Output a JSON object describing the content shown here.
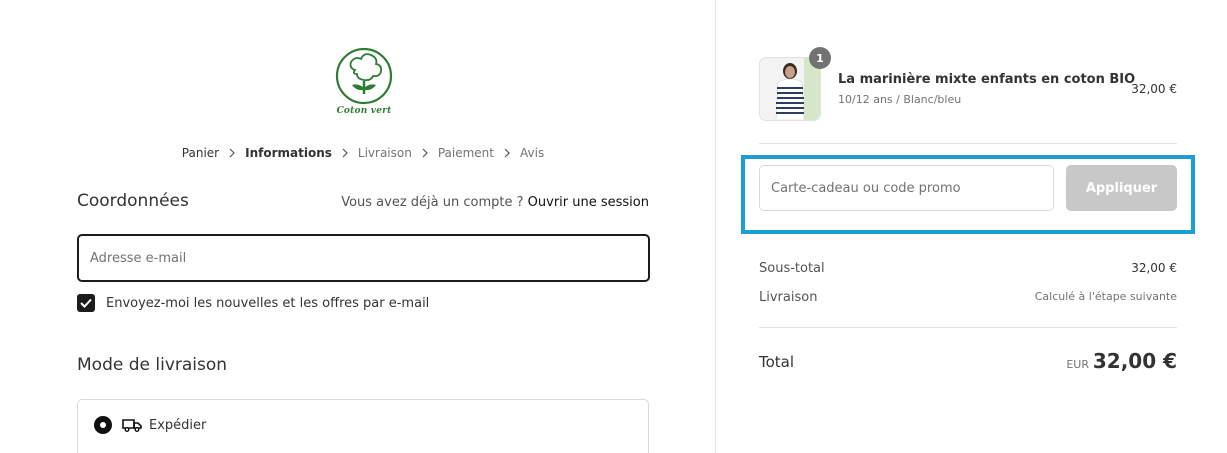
{
  "brand": {
    "logo_text": "Coton vert",
    "brand_color": "#2e7d32"
  },
  "breadcrumb": {
    "items": [
      {
        "label": "Panier",
        "state": "done"
      },
      {
        "label": "Informations",
        "state": "active"
      },
      {
        "label": "Livraison",
        "state": "upcoming"
      },
      {
        "label": "Paiement",
        "state": "upcoming"
      },
      {
        "label": "Avis",
        "state": "upcoming"
      }
    ],
    "separator_icon": "chevron-right-icon"
  },
  "contact": {
    "title": "Coordonnées",
    "login_prompt": "Vous avez déjà un compte ?",
    "login_link": "Ouvrir une session",
    "email_placeholder": "Adresse e-mail",
    "email_value": "",
    "newsletter_label": "Envoyez-moi les nouvelles et les offres par e-mail",
    "newsletter_checked": true
  },
  "shipping_method": {
    "title": "Mode de livraison",
    "option_label": "Expédier",
    "option_icon": "truck-icon",
    "selected": true
  },
  "order": {
    "product": {
      "name": "La marinière mixte enfants en coton BIO",
      "variant": "10/12 ans / Blanc/bleu",
      "price": "32,00 €",
      "quantity": "1"
    },
    "promo": {
      "placeholder": "Carte-cadeau ou code promo",
      "value": "",
      "apply_label": "Appliquer",
      "highlight_color": "#1a9ed4"
    },
    "summary": {
      "subtotal_label": "Sous-total",
      "subtotal_value": "32,00 €",
      "shipping_label": "Livraison",
      "shipping_value": "Calculé à l'étape suivante"
    },
    "total": {
      "label": "Total",
      "currency": "EUR",
      "amount": "32,00 €"
    }
  }
}
